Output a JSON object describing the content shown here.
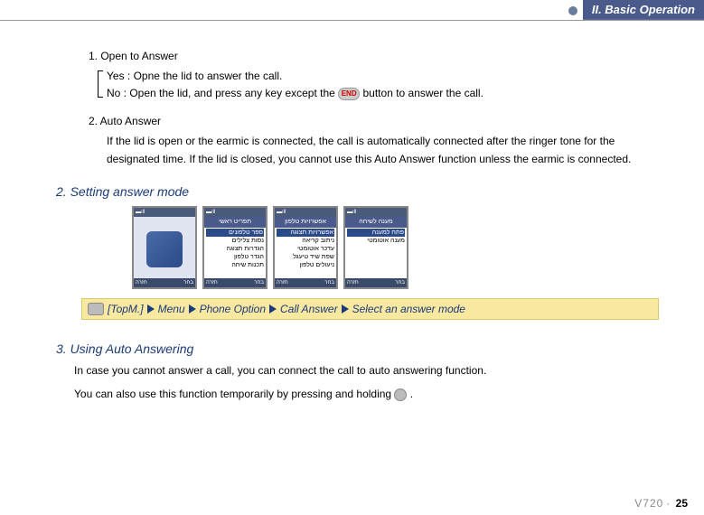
{
  "header": {
    "title": "II. Basic Operation"
  },
  "item1": {
    "title": "1. Open to Answer",
    "yes": "Yes : Opne the lid to answer the call.",
    "no_a": "No : Open the lid, and press any key except the ",
    "no_b": " button to answer the call.",
    "end_icon_label": "END"
  },
  "item2": {
    "title": "2. Auto Answer",
    "line1": "If the lid is open or the earmic is connected, the call is automatically connected after the ringer tone for the",
    "line2": "designated time. If the lid is closed, you cannot use this Auto Answer function unless the earmic is connected."
  },
  "section2": {
    "title": "2. Setting answer mode"
  },
  "phones": {
    "sig_text": "▬ıll",
    "header2": "תפריט ראשי",
    "header3": "אפשרויות טלפון",
    "header4": "מענה לשיחה",
    "list2": [
      "ספר טלפונים",
      "נסות צלילים",
      "הגדרות תצוגה",
      "הגדר טלפון",
      "תכנות שיחה"
    ],
    "list3": [
      "אפשרויות תצוגה",
      "ניתוב קריאה",
      "עדכר אוטומטי",
      "שפת שיד טיעגל",
      "ניעולים טלפון"
    ],
    "list4": [
      "פתח למענה",
      "מענה אוטומטי"
    ],
    "soft_l": "בחר",
    "soft_r": "חזרה"
  },
  "nav": {
    "top": "[TopM.]",
    "menu": "Menu",
    "phone_option": "Phone Option",
    "call_answer": "Call Answer",
    "select": "Select an answer mode"
  },
  "section3": {
    "title": "3. Using Auto Answering",
    "line1": "In case you cannot answer a call, you can connect the call to auto answering function.",
    "line2a": "You can also use this function temporarily by pressing and holding ",
    "line2b": " ."
  },
  "footer": {
    "model": "V720",
    "page": "25"
  }
}
